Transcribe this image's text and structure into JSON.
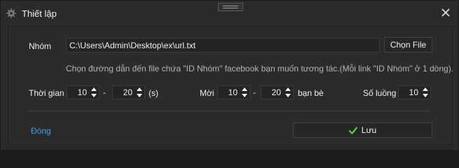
{
  "window": {
    "title": "Thiết lập",
    "icons": {
      "app": "gear-icon",
      "close": "close-icon",
      "grip": "drag-grip-icon"
    }
  },
  "group": {
    "label": "Nhóm",
    "path_value": "C:\\Users\\Admin\\Desktop\\ex\\url.txt",
    "choose_button": "Chọn File",
    "hint": "Chọn đường dẫn đến file chứa \"ID Nhóm\" facebook bạn muốn tương tác.(Mỗi link \"ID Nhóm\" ở 1 dòng)."
  },
  "time": {
    "label": "Thời gian",
    "from": "10",
    "dash": "-",
    "to": "20",
    "unit": "(s)"
  },
  "invite": {
    "label": "Mời",
    "from": "10",
    "dash": "-",
    "to": "20",
    "unit": "bạn bè"
  },
  "threads": {
    "label": "Số luồng",
    "value": "10"
  },
  "footer": {
    "close_link": "Đóng",
    "save_button": "Lưu",
    "save_icon": "check-icon"
  },
  "colors": {
    "background": "#2b2b2b",
    "link": "#3f9cf0",
    "check": "#5cc93a",
    "hint_text": "#b5b5b5"
  }
}
